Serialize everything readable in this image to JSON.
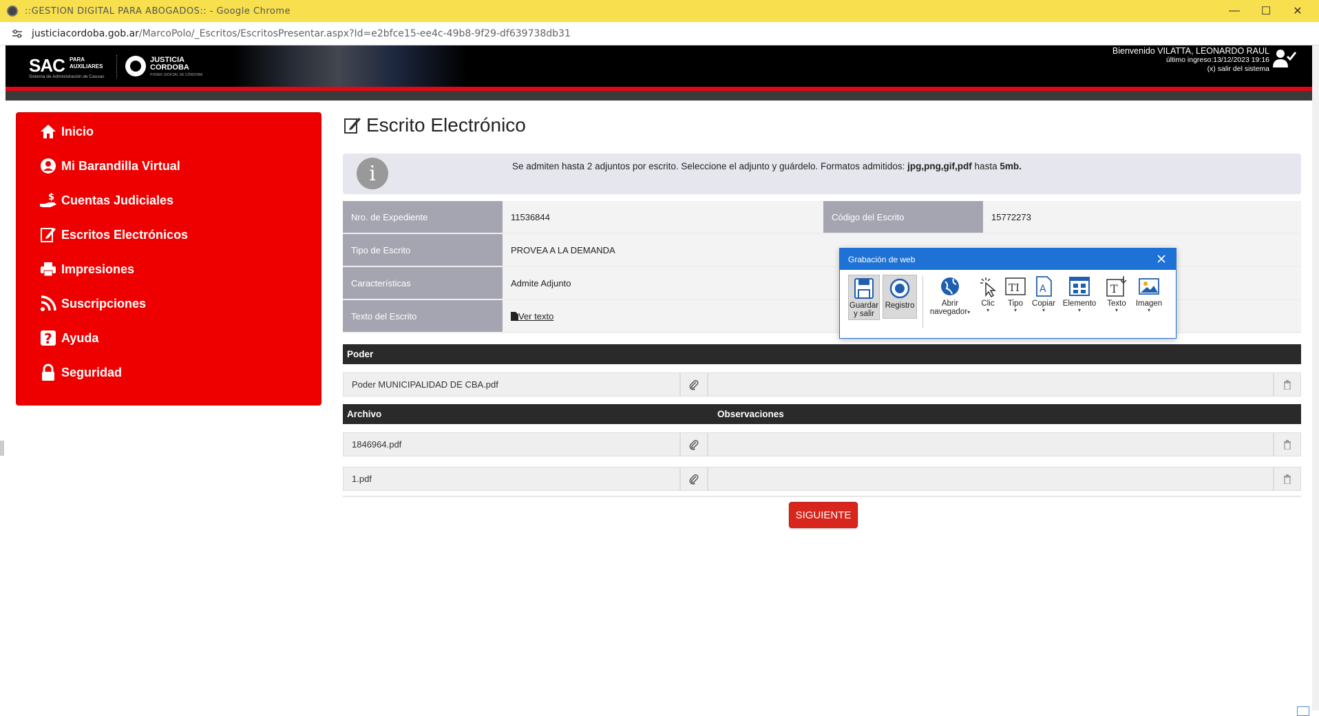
{
  "browser": {
    "title": "::GESTION DIGITAL PARA ABOGADOS:: - Google Chrome",
    "url_domain": "justiciacordoba.gob.ar",
    "url_path": "/MarcoPolo/_Escritos/EscritosPresentar.aspx?Id=e2bfce15-ee4c-49b8-9f29-df639738db31"
  },
  "header": {
    "sac": "SAC",
    "sac_sub1": "PARA",
    "sac_sub2": "AUXILIARES",
    "sac_tagline": "Sistema de Administración de Causas",
    "justicia1": "JUSTICIA",
    "justicia2": "CORDOBA",
    "justicia_tagline": "PODER JUDICIAL DE CÓRDOBA",
    "welcome": "Bienvenido VILATTA, LEONARDO RAUL",
    "last_login": "último ingreso:13/12/2023 19:16",
    "logout": "(x) salir del sistema"
  },
  "sidebar": {
    "items": [
      {
        "label": "Inicio",
        "icon": "home-icon"
      },
      {
        "label": "Mi Barandilla Virtual",
        "icon": "user-circle-icon"
      },
      {
        "label": "Cuentas Judiciales",
        "icon": "money-hand-icon"
      },
      {
        "label": "Escritos Electrónicos",
        "icon": "edit-document-icon"
      },
      {
        "label": "Impresiones",
        "icon": "printer-icon"
      },
      {
        "label": "Suscripciones",
        "icon": "rss-icon"
      },
      {
        "label": "Ayuda",
        "icon": "question-icon"
      },
      {
        "label": "Seguridad",
        "icon": "lock-icon"
      }
    ]
  },
  "main": {
    "title": "Escrito Electrónico",
    "info_text_pre": "Se admiten hasta 2 adjuntos por escrito. Seleccione el adjunto y guárdelo. Formatos admitidos: ",
    "info_formats": "jpg,png,gif,pdf",
    "info_mid": " hasta ",
    "info_size": "5mb.",
    "fields": {
      "expediente_label": "Nro. de Expediente",
      "expediente_value": "11536844",
      "codigo_label": "Código del Escrito",
      "codigo_value": "15772273",
      "tipo_label": "Tipo de Escrito",
      "tipo_value": "PROVEA A LA DEMANDA",
      "caracteristicas_label": "Características",
      "caracteristicas_value": "Admite Adjunto",
      "texto_label": "Texto del Escrito",
      "texto_link": "Ver texto"
    },
    "poder_header": "Poder",
    "poder_file": "Poder MUNICIPALIDAD DE CBA.pdf",
    "archivo_header": "Archivo",
    "observaciones_header": "Observaciones",
    "files": [
      "1846964.pdf",
      "1.pdf"
    ],
    "next_button": "SIGUIENTE"
  },
  "recorder": {
    "title": "Grabación de web",
    "tools": [
      {
        "label1": "Guardar",
        "label2": "y salir",
        "icon": "save-icon"
      },
      {
        "label1": "Registro",
        "label2": "",
        "icon": "record-icon"
      },
      {
        "label1": "Abrir",
        "label2": "navegador",
        "icon": "globe-icon"
      },
      {
        "label1": "Clic",
        "label2": "",
        "icon": "click-icon"
      },
      {
        "label1": "Tipo",
        "label2": "",
        "icon": "type-icon"
      },
      {
        "label1": "Copiar",
        "label2": "",
        "icon": "copy-icon"
      },
      {
        "label1": "Elemento",
        "label2": "",
        "icon": "element-icon"
      },
      {
        "label1": "Texto",
        "label2": "",
        "icon": "text-icon"
      },
      {
        "label1": "Imagen",
        "label2": "",
        "icon": "image-icon"
      }
    ]
  },
  "colors": {
    "sidebar_red": "#ee0000",
    "label_grey": "#a5a5b1",
    "recorder_blue": "#1e72d6",
    "button_red": "#d9261c"
  }
}
